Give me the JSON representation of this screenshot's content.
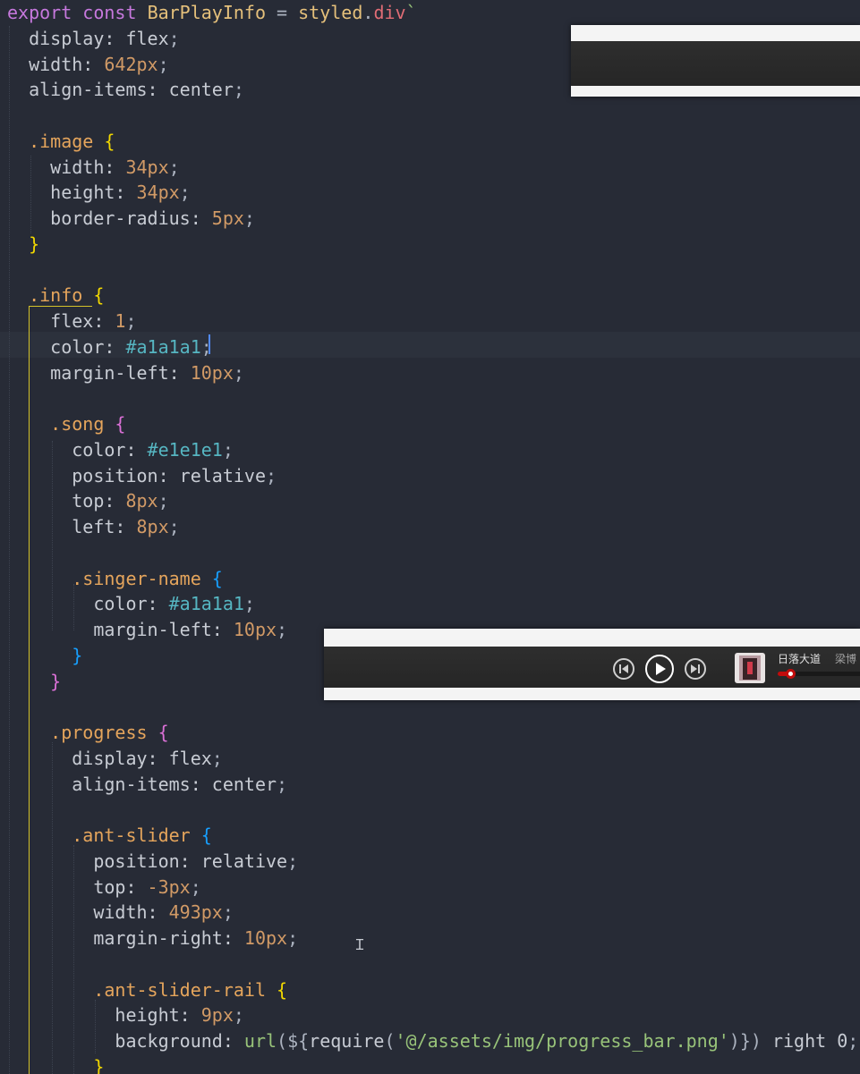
{
  "editor": {
    "lines": [
      [
        [
          "kw",
          "export"
        ],
        [
          "pun",
          " "
        ],
        [
          "kw",
          "const"
        ],
        [
          "pun",
          " "
        ],
        [
          "fn",
          "BarPlayInfo"
        ],
        [
          "pun",
          " = "
        ],
        [
          "fn",
          "styled"
        ],
        [
          "pun",
          "."
        ],
        [
          "tpl",
          "div"
        ],
        [
          "str",
          "`"
        ]
      ],
      [
        [
          "prop",
          "  display: "
        ],
        [
          "prop",
          "flex"
        ],
        [
          "pun",
          ";"
        ]
      ],
      [
        [
          "prop",
          "  width: "
        ],
        [
          "num",
          "642px"
        ],
        [
          "pun",
          ";"
        ]
      ],
      [
        [
          "prop",
          "  align-items: "
        ],
        [
          "prop",
          "center"
        ],
        [
          "pun",
          ";"
        ]
      ],
      [],
      [
        [
          "sel",
          "  .image "
        ],
        [
          "b1",
          "{"
        ]
      ],
      [
        [
          "prop",
          "    width: "
        ],
        [
          "num",
          "34px"
        ],
        [
          "pun",
          ";"
        ]
      ],
      [
        [
          "prop",
          "    height: "
        ],
        [
          "num",
          "34px"
        ],
        [
          "pun",
          ";"
        ]
      ],
      [
        [
          "prop",
          "    border-radius: "
        ],
        [
          "num",
          "5px"
        ],
        [
          "pun",
          ";"
        ]
      ],
      [
        [
          "b1",
          "  }"
        ]
      ],
      [],
      [
        [
          "sel",
          "  .info "
        ],
        [
          "b1",
          "{"
        ]
      ],
      [
        [
          "prop",
          "    flex: "
        ],
        [
          "num",
          "1"
        ],
        [
          "pun",
          ";"
        ]
      ],
      [
        [
          "prop",
          "    color: "
        ],
        [
          "hex",
          "#a1a1a1"
        ],
        [
          "pun",
          ";"
        ]
      ],
      [
        [
          "prop",
          "    margin-left: "
        ],
        [
          "num",
          "10px"
        ],
        [
          "pun",
          ";"
        ]
      ],
      [],
      [
        [
          "sel",
          "    .song "
        ],
        [
          "b2",
          "{"
        ]
      ],
      [
        [
          "prop",
          "      color: "
        ],
        [
          "hex",
          "#e1e1e1"
        ],
        [
          "pun",
          ";"
        ]
      ],
      [
        [
          "prop",
          "      position: "
        ],
        [
          "prop",
          "relative"
        ],
        [
          "pun",
          ";"
        ]
      ],
      [
        [
          "prop",
          "      top: "
        ],
        [
          "num",
          "8px"
        ],
        [
          "pun",
          ";"
        ]
      ],
      [
        [
          "prop",
          "      left: "
        ],
        [
          "num",
          "8px"
        ],
        [
          "pun",
          ";"
        ]
      ],
      [],
      [
        [
          "sel",
          "      .singer-name "
        ],
        [
          "b3",
          "{"
        ]
      ],
      [
        [
          "prop",
          "        color: "
        ],
        [
          "hex",
          "#a1a1a1"
        ],
        [
          "pun",
          ";"
        ]
      ],
      [
        [
          "prop",
          "        margin-left: "
        ],
        [
          "num",
          "10px"
        ],
        [
          "pun",
          ";"
        ]
      ],
      [
        [
          "b3",
          "      }"
        ]
      ],
      [
        [
          "b2",
          "    }"
        ]
      ],
      [],
      [
        [
          "sel",
          "    .progress "
        ],
        [
          "b2",
          "{"
        ]
      ],
      [
        [
          "prop",
          "      display: "
        ],
        [
          "prop",
          "flex"
        ],
        [
          "pun",
          ";"
        ]
      ],
      [
        [
          "prop",
          "      align-items: "
        ],
        [
          "prop",
          "center"
        ],
        [
          "pun",
          ";"
        ]
      ],
      [],
      [
        [
          "sel",
          "      .ant-slider "
        ],
        [
          "b3",
          "{"
        ]
      ],
      [
        [
          "prop",
          "        position: "
        ],
        [
          "prop",
          "relative"
        ],
        [
          "pun",
          ";"
        ]
      ],
      [
        [
          "prop",
          "        top: "
        ],
        [
          "num",
          "-3px"
        ],
        [
          "pun",
          ";"
        ]
      ],
      [
        [
          "prop",
          "        width: "
        ],
        [
          "num",
          "493px"
        ],
        [
          "pun",
          ";"
        ]
      ],
      [
        [
          "prop",
          "        margin-right: "
        ],
        [
          "num",
          "10px"
        ],
        [
          "pun",
          ";"
        ]
      ],
      [],
      [
        [
          "sel",
          "        .ant-slider-rail "
        ],
        [
          "b1",
          "{"
        ]
      ],
      [
        [
          "prop",
          "          height: "
        ],
        [
          "num",
          "9px"
        ],
        [
          "pun",
          ";"
        ]
      ],
      [
        [
          "prop",
          "          background: "
        ],
        [
          "str",
          "url"
        ],
        [
          "pun",
          "("
        ],
        [
          "pun",
          "${"
        ],
        [
          "prop",
          "require"
        ],
        [
          "pun",
          "("
        ],
        [
          "str",
          "'@/assets/img/progress_bar.png'"
        ],
        [
          "pun",
          ")"
        ],
        [
          "pun",
          "}"
        ],
        [
          "pun",
          ")"
        ],
        [
          "prop",
          " right 0"
        ],
        [
          "pun",
          ";"
        ]
      ],
      [
        [
          "b1",
          "        }"
        ]
      ]
    ]
  },
  "player": {
    "song_title": "日落大道",
    "singer": "梁博",
    "progress_fraction": 0.12
  },
  "colors": {
    "background": "#272b36",
    "accent": "#d4c22a",
    "progress": "#c20c0c"
  },
  "icons": [
    "prev-icon",
    "play-icon",
    "next-icon",
    "album-cover-icon",
    "text-cursor-icon"
  ]
}
